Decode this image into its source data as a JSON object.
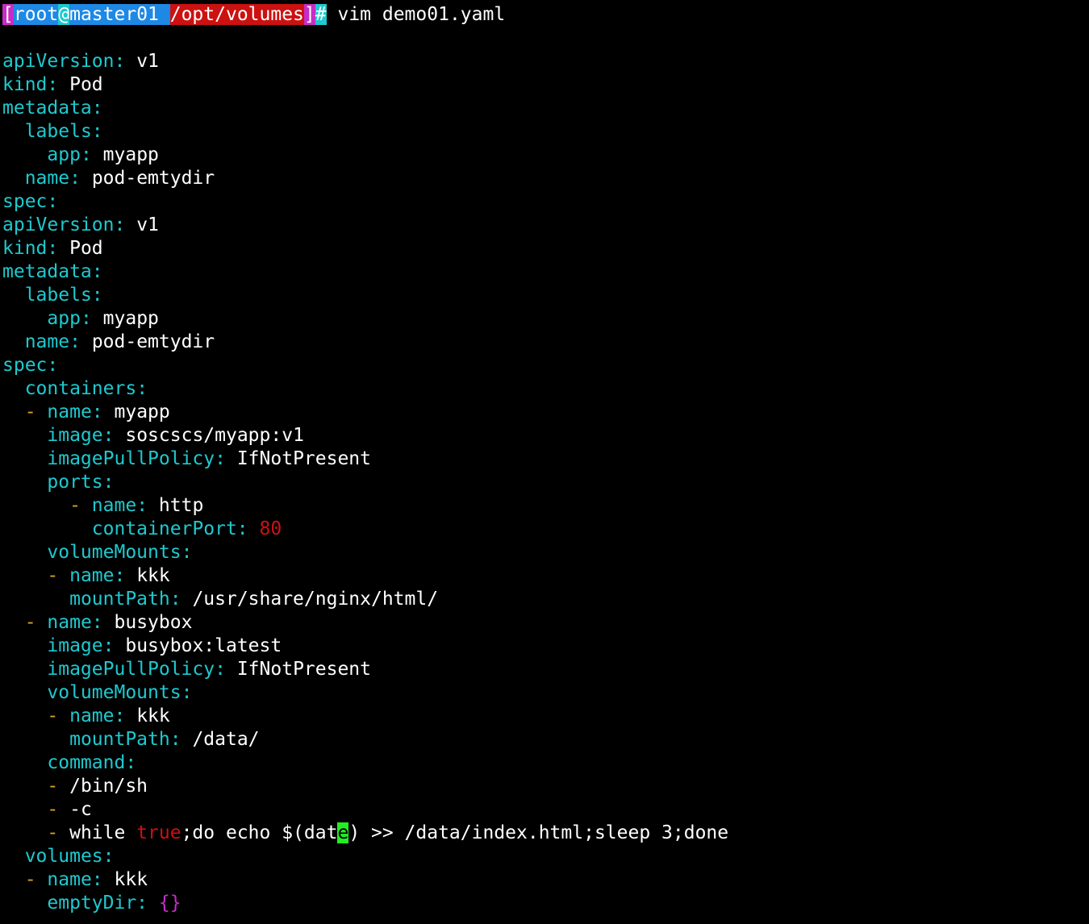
{
  "prompt": {
    "open_bracket": "[",
    "user": "root",
    "at": "@",
    "host": "master01 ",
    "path": "/opt/volumes",
    "close_bracket": "]",
    "hash": "#",
    "command": " vim demo01.yaml"
  },
  "colors": {
    "background": "#000000",
    "key": "#1ec9cf",
    "dash": "#d7a323",
    "number": "#cc1111",
    "brace": "#c62dc6",
    "cursor": "#22ee22"
  },
  "lines": [
    {
      "t": "blank"
    },
    {
      "t": "kv",
      "indent": "",
      "dash": "",
      "key": "apiVersion",
      "val": "v1"
    },
    {
      "t": "kv",
      "indent": "",
      "dash": "",
      "key": "kind",
      "val": "Pod"
    },
    {
      "t": "kv",
      "indent": "",
      "dash": "",
      "key": "metadata",
      "val": ""
    },
    {
      "t": "kv",
      "indent": "  ",
      "dash": "",
      "key": "labels",
      "val": ""
    },
    {
      "t": "kv",
      "indent": "    ",
      "dash": "",
      "key": "app",
      "val": "myapp"
    },
    {
      "t": "kv",
      "indent": "  ",
      "dash": "",
      "key": "name",
      "val": "pod-emtydir"
    },
    {
      "t": "kv",
      "indent": "",
      "dash": "",
      "key": "spec",
      "val": ""
    },
    {
      "t": "kv",
      "indent": "",
      "dash": "",
      "key": "apiVersion",
      "val": "v1"
    },
    {
      "t": "kv",
      "indent": "",
      "dash": "",
      "key": "kind",
      "val": "Pod"
    },
    {
      "t": "kv",
      "indent": "",
      "dash": "",
      "key": "metadata",
      "val": ""
    },
    {
      "t": "kv",
      "indent": "  ",
      "dash": "",
      "key": "labels",
      "val": ""
    },
    {
      "t": "kv",
      "indent": "    ",
      "dash": "",
      "key": "app",
      "val": "myapp"
    },
    {
      "t": "kv",
      "indent": "  ",
      "dash": "",
      "key": "name",
      "val": "pod-emtydir"
    },
    {
      "t": "kv",
      "indent": "",
      "dash": "",
      "key": "spec",
      "val": ""
    },
    {
      "t": "kv",
      "indent": "  ",
      "dash": "",
      "key": "containers",
      "val": ""
    },
    {
      "t": "kv",
      "indent": "  ",
      "dash": "- ",
      "key": "name",
      "val": "myapp"
    },
    {
      "t": "kv",
      "indent": "    ",
      "dash": "",
      "key": "image",
      "val": "soscscs/myapp:v1"
    },
    {
      "t": "kv",
      "indent": "    ",
      "dash": "",
      "key": "imagePullPolicy",
      "val": "IfNotPresent"
    },
    {
      "t": "kv",
      "indent": "    ",
      "dash": "",
      "key": "ports",
      "val": ""
    },
    {
      "t": "kv",
      "indent": "      ",
      "dash": "- ",
      "key": "name",
      "val": "http"
    },
    {
      "t": "kv",
      "indent": "        ",
      "dash": "",
      "key": "containerPort",
      "num": "80"
    },
    {
      "t": "kv",
      "indent": "    ",
      "dash": "",
      "key": "volumeMounts",
      "val": ""
    },
    {
      "t": "kv",
      "indent": "    ",
      "dash": "- ",
      "key": "name",
      "val": "kkk"
    },
    {
      "t": "kv",
      "indent": "      ",
      "dash": "",
      "key": "mountPath",
      "val": "/usr/share/nginx/html/"
    },
    {
      "t": "kv",
      "indent": "  ",
      "dash": "- ",
      "key": "name",
      "val": "busybox"
    },
    {
      "t": "kv",
      "indent": "    ",
      "dash": "",
      "key": "image",
      "val": "busybox:latest"
    },
    {
      "t": "kv",
      "indent": "    ",
      "dash": "",
      "key": "imagePullPolicy",
      "val": "IfNotPresent"
    },
    {
      "t": "kv",
      "indent": "    ",
      "dash": "",
      "key": "volumeMounts",
      "val": ""
    },
    {
      "t": "kv",
      "indent": "    ",
      "dash": "- ",
      "key": "name",
      "val": "kkk"
    },
    {
      "t": "kv",
      "indent": "      ",
      "dash": "",
      "key": "mountPath",
      "val": "/data/"
    },
    {
      "t": "kv",
      "indent": "    ",
      "dash": "",
      "key": "command",
      "val": ""
    },
    {
      "t": "item",
      "indent": "    ",
      "dash": "- ",
      "val": "/bin/sh"
    },
    {
      "t": "item",
      "indent": "    ",
      "dash": "- ",
      "val": "-c"
    },
    {
      "t": "cmd",
      "indent": "    ",
      "dash": "- ",
      "pre": "while ",
      "bool": "true",
      "mid": ";do echo $(dat",
      "cursor": "e",
      "post": ") >> /data/index.html;sleep 3;done"
    },
    {
      "t": "kv",
      "indent": "  ",
      "dash": "",
      "key": "volumes",
      "val": ""
    },
    {
      "t": "kv",
      "indent": "  ",
      "dash": "- ",
      "key": "name",
      "val": "kkk"
    },
    {
      "t": "kv",
      "indent": "    ",
      "dash": "",
      "key": "emptyDir",
      "brace": "{}"
    }
  ]
}
